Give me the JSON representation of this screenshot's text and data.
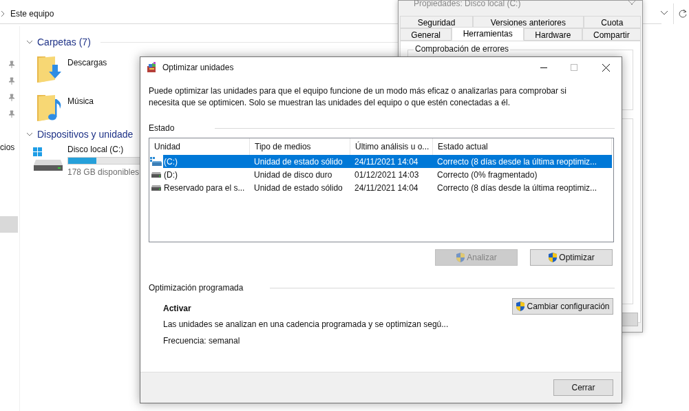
{
  "explorer": {
    "address": {
      "path": "Este equipo"
    },
    "sidebar": {
      "items": [
        {
          "label": "cios"
        }
      ]
    },
    "sections": [
      {
        "title": "Carpetas (7)",
        "expanded": true,
        "items": [
          {
            "kind": "downloads",
            "name": "Descargas"
          },
          {
            "kind": "music",
            "name": "Música"
          }
        ]
      },
      {
        "title": "Dispositivos y unidade",
        "expanded": true,
        "items": [
          {
            "kind": "drive",
            "name": "Disco local (C:)",
            "level": 0.38,
            "free": "178 GB disponibles"
          }
        ]
      }
    ]
  },
  "properties": {
    "title": "Propiedades: Disco local (C:)",
    "tab_rows": [
      [
        {
          "label": "Seguridad",
          "selected": false
        },
        {
          "label": "Versiones anteriores",
          "selected": false
        },
        {
          "label": "Cuota",
          "selected": false
        }
      ],
      [
        {
          "label": "General",
          "selected": false
        },
        {
          "label": "Herramientas",
          "selected": true
        },
        {
          "label": "Hardware",
          "selected": false
        },
        {
          "label": "Compartir",
          "selected": false
        }
      ]
    ],
    "group": "Comprobación de errores"
  },
  "dialog": {
    "title": "Optimizar unidades",
    "description": "Puede optimizar las unidades para que el equipo funcione de un modo más eficaz o analizarlas para comprobar si necesita que se optimicen. Solo se muestran las unidades del equipo o que estén conectadas a él.",
    "status_label": "Estado",
    "columns": [
      "Unidad",
      "Tipo de medios",
      "Último análisis u o...",
      "Estado actual"
    ],
    "rows": [
      {
        "kind": "system",
        "unit": "(C:)",
        "media": "Unidad de estado sólido",
        "last": "24/11/2021 14:04",
        "state": "Correcto (8 días desde la última reoptimiz...",
        "selected": true
      },
      {
        "kind": "disk",
        "unit": "(D:)",
        "media": "Unidad de disco duro",
        "last": "01/12/2021 14:03",
        "state": "Correcto (0% fragmentado)",
        "selected": false
      },
      {
        "kind": "disk",
        "unit": "Reservado para el s...",
        "media": "Unidad de estado sólido",
        "last": "24/11/2021 14:04",
        "state": "Correcto (8 días desde la última reoptimiz...",
        "selected": false
      }
    ],
    "buttons": [
      {
        "label": "Analizar",
        "disabled": true
      },
      {
        "label": "Optimizar",
        "disabled": false
      }
    ],
    "scheduled": {
      "label": "Optimización programada",
      "heading": "Activar",
      "text": "Las unidades se analizan en una cadencia programada y se optimizan segú...",
      "frequency": "Frecuencia: semanal",
      "button": "Cambiar configuración"
    },
    "close_button": "Cerrar"
  }
}
